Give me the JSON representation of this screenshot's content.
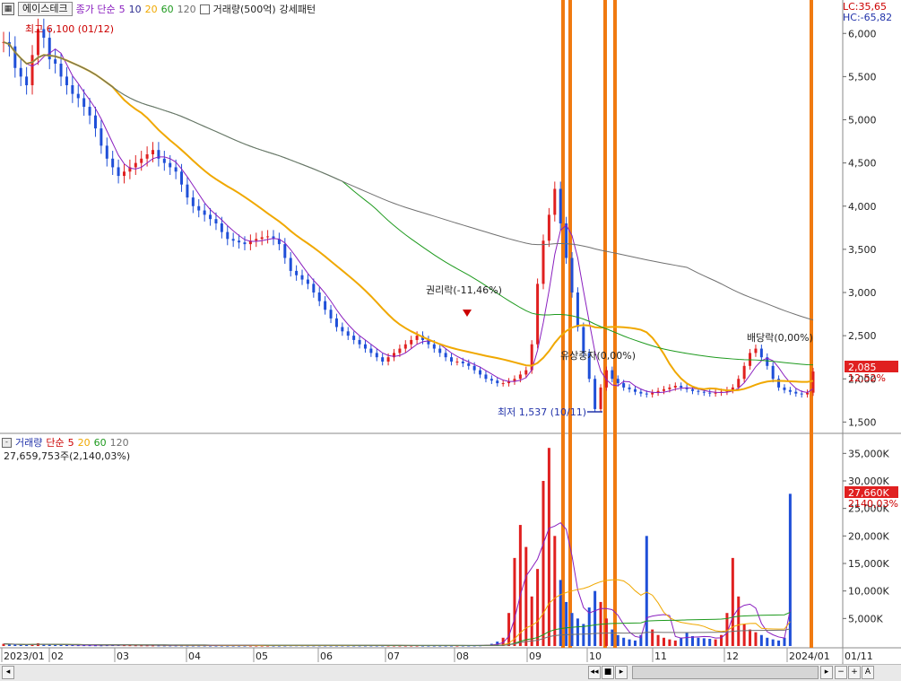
{
  "header": {
    "stock_name": "에이스테크",
    "ma_label": "종가 단순",
    "ma_periods": [
      "5",
      "10",
      "20",
      "60",
      "120"
    ],
    "volume_unit": "거래량(500억)",
    "pattern": "강세패턴"
  },
  "indicators": {
    "lc": "LC:35,65",
    "hc": "HC:-65,82"
  },
  "price": {
    "current": "2,085",
    "change_pct": "12,52%",
    "high_label": "최고 6,100 (01/12)",
    "low_label": "최저 1,537 (10/11)",
    "annotations": {
      "rights": "권리락(-11,46%)",
      "capital_increase": "유상증자(0,00%)",
      "dividend": "배당락(0,00%)"
    }
  },
  "volume": {
    "title": "거래량",
    "ma_label": "단순",
    "ma_periods": [
      "5",
      "20",
      "60",
      "120"
    ],
    "value_text": "27,659,753주(2,140,03%)",
    "current": "27,660K",
    "current_pct": "2140,03%"
  },
  "axes": {
    "price_ticks": [
      "6,000",
      "5,500",
      "5,000",
      "4,500",
      "4,000",
      "3,500",
      "3,000",
      "2,500",
      "2,000",
      "1,500"
    ],
    "volume_ticks": [
      "35,000K",
      "30,000K",
      "25,000K",
      "20,000K",
      "15,000K",
      "10,000K",
      "5,000K"
    ],
    "months": [
      "2023/01",
      "02",
      "03",
      "04",
      "05",
      "06",
      "07",
      "08",
      "09",
      "10",
      "11",
      "12",
      "2024/01",
      "01/11"
    ]
  },
  "colors": {
    "up": "#e02020",
    "down": "#1f4fd8",
    "ma5": "#8a1fbf",
    "ma10": "#2b2b8f",
    "ma20": "#f0a800",
    "ma60": "#1e9a1e",
    "ma120": "#707070",
    "marker": "#f07a10",
    "label_red": "#cc0000",
    "label_blue": "#2233aa"
  },
  "chart_data": {
    "type": "candlestick",
    "dates_start": "2023/01",
    "x": [
      "01",
      "01",
      "01",
      "01",
      "01",
      "01",
      "01",
      "01",
      "01",
      "01",
      "02",
      "02",
      "02",
      "02",
      "02",
      "02",
      "02",
      "02",
      "02",
      "02",
      "02",
      "02",
      "02",
      "02",
      "02",
      "02",
      "02",
      "02",
      "02",
      "02",
      "03",
      "03",
      "03",
      "03",
      "03",
      "03",
      "03",
      "03",
      "03",
      "03",
      "03",
      "03",
      "03",
      "03",
      "03",
      "03",
      "03",
      "03",
      "03",
      "03",
      "03",
      "03",
      "04",
      "04",
      "04",
      "04",
      "04",
      "04",
      "04",
      "04",
      "04",
      "04",
      "04",
      "04",
      "04",
      "04",
      "04",
      "04",
      "04",
      "04",
      "04",
      "05",
      "05",
      "05",
      "05",
      "05",
      "05",
      "05",
      "05",
      "05",
      "05",
      "05",
      "05",
      "05",
      "05",
      "05",
      "05",
      "05",
      "05",
      "05",
      "05",
      "05",
      "06",
      "06",
      "06",
      "06",
      "06",
      "06",
      "06",
      "06",
      "06",
      "06",
      "06",
      "06",
      "06",
      "06",
      "06",
      "06",
      "06",
      "06",
      "06",
      "06",
      "07",
      "07",
      "07",
      "07",
      "07",
      "07",
      "07",
      "07",
      "07",
      "07",
      "07",
      "07",
      "07",
      "07",
      "07",
      "07",
      "07",
      "07",
      "07",
      "07",
      "08",
      "08",
      "08",
      "08",
      "08",
      "08",
      "08",
      "08",
      "08",
      "08",
      "08",
      "08",
      "08",
      "08",
      "08",
      "08",
      "08",
      "08",
      "08",
      "08",
      "08",
      "09",
      "09",
      "09",
      "09",
      "09",
      "09",
      "09",
      "09",
      "09",
      "09",
      "09",
      "09",
      "09",
      "09",
      "09",
      "09",
      "09",
      "09",
      "09",
      "09",
      "10",
      "10",
      "10",
      "10",
      "10",
      "10",
      "10",
      "10",
      "10",
      "10",
      "10",
      "10",
      "10",
      "10",
      "10",
      "10",
      "10",
      "10",
      "11",
      "11",
      "11",
      "11",
      "11",
      "11",
      "11",
      "11",
      "11",
      "11",
      "11",
      "11",
      "11",
      "11",
      "11",
      "11",
      "11",
      "11",
      "11",
      "11",
      "11",
      "11",
      "12",
      "12",
      "12",
      "12",
      "12",
      "12",
      "12",
      "12",
      "12",
      "12",
      "12",
      "12",
      "12",
      "12",
      "12",
      "12",
      "12",
      "12",
      "12",
      "12",
      "2024/01",
      "2024/01",
      "2024/01",
      "2024/01",
      "2024/01",
      "2024/01",
      "2024/01"
    ],
    "close": [
      5900,
      5850,
      5600,
      5500,
      5400,
      5750,
      6050,
      5950,
      5700,
      5650,
      5500,
      5400,
      5300,
      5250,
      5150,
      5050,
      4900,
      4700,
      4550,
      4450,
      4350,
      4400,
      4450,
      4500,
      4550,
      4600,
      4650,
      4550,
      4500,
      4450,
      4400,
      4250,
      4100,
      4000,
      3950,
      3900,
      3850,
      3800,
      3700,
      3620,
      3600,
      3580,
      3560,
      3600,
      3620,
      3640,
      3650,
      3620,
      3560,
      3400,
      3250,
      3200,
      3150,
      3100,
      3000,
      2900,
      2800,
      2700,
      2600,
      2550,
      2500,
      2450,
      2400,
      2350,
      2300,
      2250,
      2200,
      2250,
      2300,
      2350,
      2400,
      2450,
      2500,
      2450,
      2400,
      2350,
      2300,
      2250,
      2200,
      2200,
      2180,
      2150,
      2100,
      2050,
      2000,
      1980,
      1950,
      1950,
      1970,
      2000,
      2050,
      2100,
      2400,
      3100,
      3600,
      3900,
      4200,
      3800,
      3400,
      3000,
      2600,
      2300,
      2000,
      1650,
      1900,
      2100,
      2000,
      1950,
      1900,
      1880,
      1850,
      1830,
      1820,
      1840,
      1860,
      1880,
      1900,
      1920,
      1900,
      1880,
      1860,
      1850,
      1840,
      1830,
      1840,
      1850,
      1870,
      1900,
      2000,
      2150,
      2300,
      2350,
      2250,
      2150,
      2000,
      1900,
      1870,
      1850,
      1830,
      1820,
      1840,
      2085
    ],
    "volume": [
      400,
      300,
      250,
      200,
      180,
      350,
      500,
      300,
      250,
      220,
      200,
      180,
      160,
      150,
      150,
      140,
      130,
      120,
      150,
      160,
      170,
      150,
      140,
      130,
      120,
      120,
      110,
      110,
      100,
      100,
      100,
      100,
      90,
      90,
      90,
      90,
      80,
      80,
      80,
      80,
      80,
      80,
      80,
      80,
      80,
      80,
      80,
      80,
      80,
      90,
      110,
      120,
      110,
      100,
      100,
      100,
      90,
      90,
      90,
      90,
      90,
      90,
      90,
      90,
      90,
      90,
      90,
      90,
      90,
      80,
      80,
      80,
      80,
      80,
      80,
      80,
      80,
      80,
      80,
      80,
      90,
      90,
      100,
      120,
      200,
      400,
      800,
      1500,
      6000,
      16000,
      22000,
      18000,
      9000,
      14000,
      30000,
      36000,
      20000,
      12000,
      8000,
      6000,
      5000,
      4000,
      7000,
      10000,
      8000,
      5000,
      3000,
      2000,
      1500,
      1200,
      1000,
      2000,
      20000,
      3000,
      2000,
      1500,
      1200,
      1000,
      1500,
      2500,
      1800,
      1500,
      1400,
      1300,
      1200,
      2000,
      6000,
      16000,
      9000,
      4000,
      3000,
      2500,
      2000,
      1500,
      1200,
      1000,
      1500,
      27660
    ],
    "ylim_price": [
      1400,
      6200
    ],
    "ylim_volume": [
      0,
      37500
    ],
    "volume_markers": [
      "09/13",
      "09/15",
      "10/05",
      "10/11",
      "01/10"
    ]
  }
}
